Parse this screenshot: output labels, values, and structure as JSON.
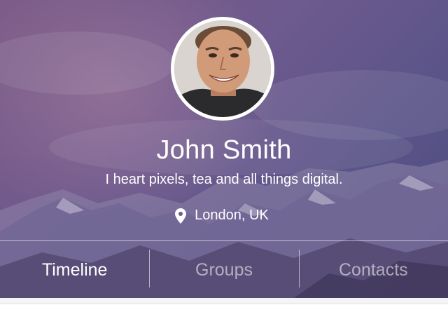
{
  "profile": {
    "name": "John Smith",
    "bio": "I heart pixels, tea and all things digital.",
    "location": "London, UK"
  },
  "tabs": [
    {
      "label": "Timeline",
      "active": true
    },
    {
      "label": "Groups",
      "active": false
    },
    {
      "label": "Contacts",
      "active": false
    }
  ],
  "icons": {
    "location": "map-pin-icon"
  },
  "colors": {
    "hero_tint": "#6e5a8e",
    "text": "#ffffff",
    "content_bg": "#f4f4f6"
  }
}
